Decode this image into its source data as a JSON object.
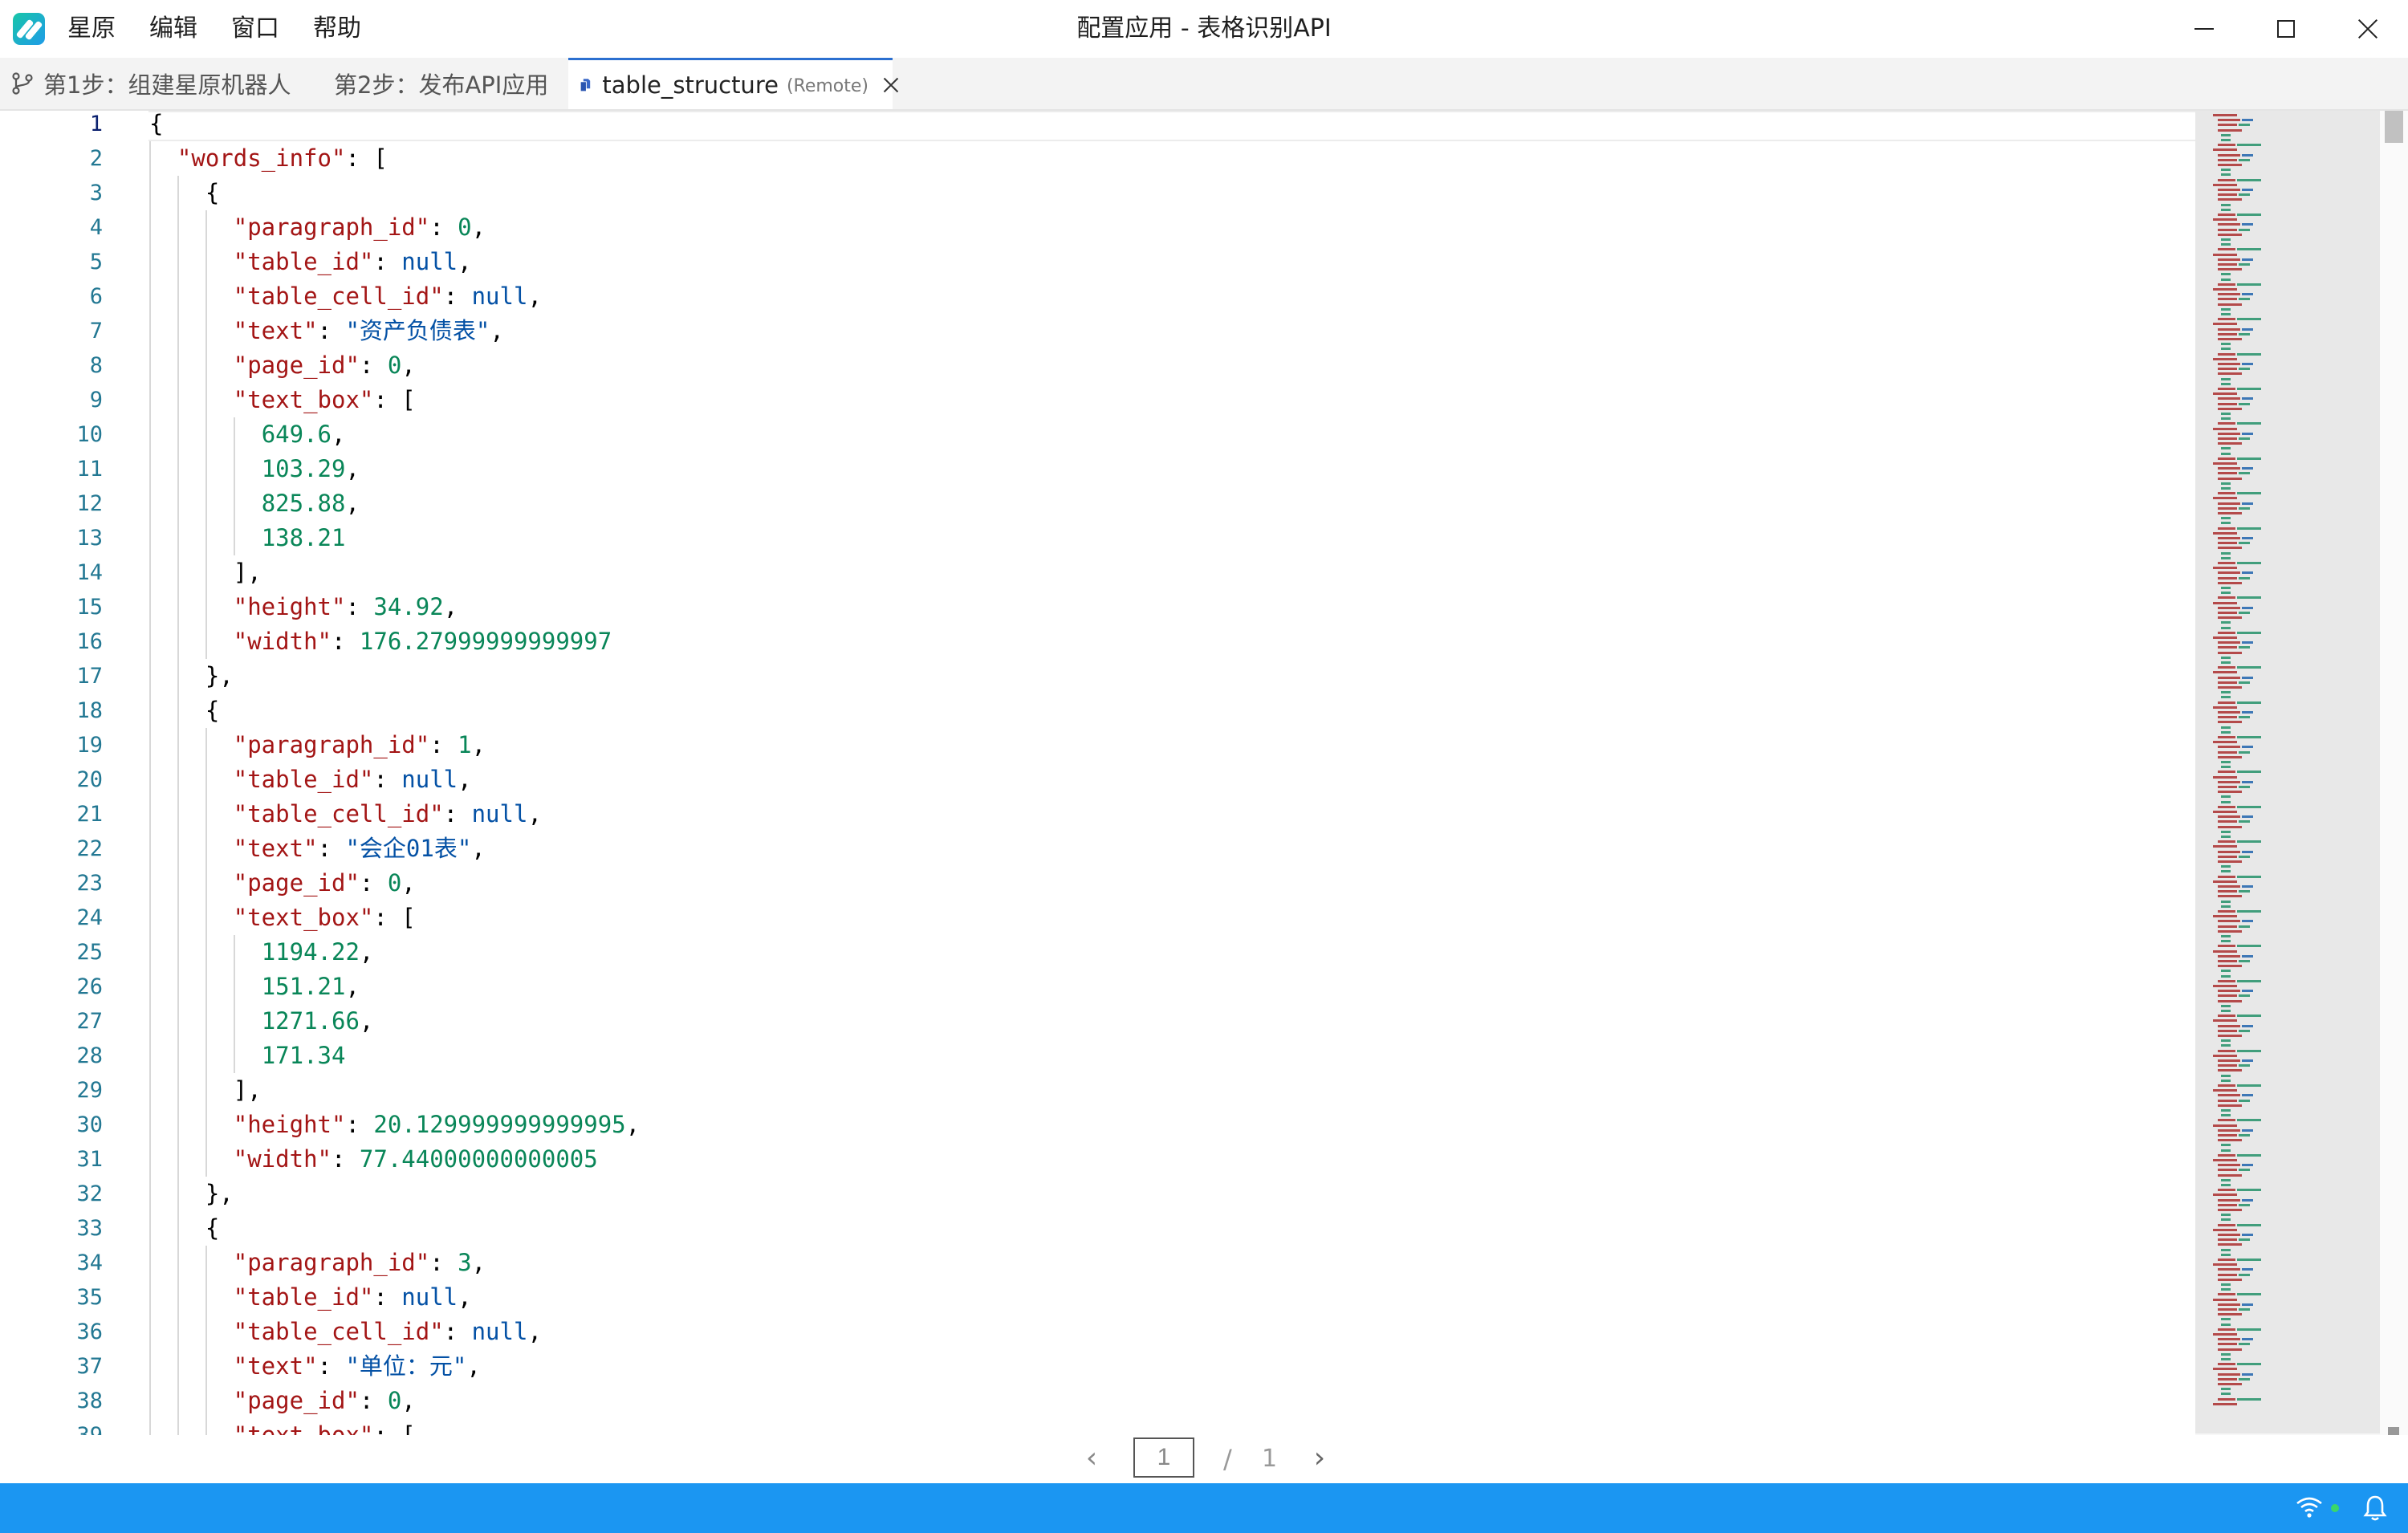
{
  "app": {
    "window_title": "配置应用 - 表格识别API",
    "menu": [
      "星原",
      "编辑",
      "窗口",
      "帮助"
    ]
  },
  "tabs": [
    {
      "label": "第1步：组建星原机器人",
      "icon": "branch-icon",
      "active": false
    },
    {
      "label": "第2步：发布API应用",
      "active": false
    },
    {
      "label": "table_structure",
      "tag": "(Remote)",
      "icon": "file-copy-icon",
      "active": true
    }
  ],
  "editor": {
    "current_line": 1,
    "lines": [
      [
        {
          "t": "{",
          "c": "p"
        }
      ],
      [
        {
          "t": "  "
        },
        {
          "t": "\"words_info\"",
          "c": "k"
        },
        {
          "t": ": [",
          "c": "p"
        }
      ],
      [
        {
          "t": "    {",
          "c": "p"
        }
      ],
      [
        {
          "t": "      "
        },
        {
          "t": "\"paragraph_id\"",
          "c": "k"
        },
        {
          "t": ": ",
          "c": "p"
        },
        {
          "t": "0",
          "c": "n"
        },
        {
          "t": ",",
          "c": "p"
        }
      ],
      [
        {
          "t": "      "
        },
        {
          "t": "\"table_id\"",
          "c": "k"
        },
        {
          "t": ": ",
          "c": "p"
        },
        {
          "t": "null",
          "c": "l"
        },
        {
          "t": ",",
          "c": "p"
        }
      ],
      [
        {
          "t": "      "
        },
        {
          "t": "\"table_cell_id\"",
          "c": "k"
        },
        {
          "t": ": ",
          "c": "p"
        },
        {
          "t": "null",
          "c": "l"
        },
        {
          "t": ",",
          "c": "p"
        }
      ],
      [
        {
          "t": "      "
        },
        {
          "t": "\"text\"",
          "c": "k"
        },
        {
          "t": ": ",
          "c": "p"
        },
        {
          "t": "\"资产负债表\"",
          "c": "s"
        },
        {
          "t": ",",
          "c": "p"
        }
      ],
      [
        {
          "t": "      "
        },
        {
          "t": "\"page_id\"",
          "c": "k"
        },
        {
          "t": ": ",
          "c": "p"
        },
        {
          "t": "0",
          "c": "n"
        },
        {
          "t": ",",
          "c": "p"
        }
      ],
      [
        {
          "t": "      "
        },
        {
          "t": "\"text_box\"",
          "c": "k"
        },
        {
          "t": ": [",
          "c": "p"
        }
      ],
      [
        {
          "t": "        "
        },
        {
          "t": "649.6",
          "c": "n"
        },
        {
          "t": ",",
          "c": "p"
        }
      ],
      [
        {
          "t": "        "
        },
        {
          "t": "103.29",
          "c": "n"
        },
        {
          "t": ",",
          "c": "p"
        }
      ],
      [
        {
          "t": "        "
        },
        {
          "t": "825.88",
          "c": "n"
        },
        {
          "t": ",",
          "c": "p"
        }
      ],
      [
        {
          "t": "        "
        },
        {
          "t": "138.21",
          "c": "n"
        }
      ],
      [
        {
          "t": "      ],",
          "c": "p"
        }
      ],
      [
        {
          "t": "      "
        },
        {
          "t": "\"height\"",
          "c": "k"
        },
        {
          "t": ": ",
          "c": "p"
        },
        {
          "t": "34.92",
          "c": "n"
        },
        {
          "t": ",",
          "c": "p"
        }
      ],
      [
        {
          "t": "      "
        },
        {
          "t": "\"width\"",
          "c": "k"
        },
        {
          "t": ": ",
          "c": "p"
        },
        {
          "t": "176.27999999999997",
          "c": "n"
        }
      ],
      [
        {
          "t": "    },",
          "c": "p"
        }
      ],
      [
        {
          "t": "    {",
          "c": "p"
        }
      ],
      [
        {
          "t": "      "
        },
        {
          "t": "\"paragraph_id\"",
          "c": "k"
        },
        {
          "t": ": ",
          "c": "p"
        },
        {
          "t": "1",
          "c": "n"
        },
        {
          "t": ",",
          "c": "p"
        }
      ],
      [
        {
          "t": "      "
        },
        {
          "t": "\"table_id\"",
          "c": "k"
        },
        {
          "t": ": ",
          "c": "p"
        },
        {
          "t": "null",
          "c": "l"
        },
        {
          "t": ",",
          "c": "p"
        }
      ],
      [
        {
          "t": "      "
        },
        {
          "t": "\"table_cell_id\"",
          "c": "k"
        },
        {
          "t": ": ",
          "c": "p"
        },
        {
          "t": "null",
          "c": "l"
        },
        {
          "t": ",",
          "c": "p"
        }
      ],
      [
        {
          "t": "      "
        },
        {
          "t": "\"text\"",
          "c": "k"
        },
        {
          "t": ": ",
          "c": "p"
        },
        {
          "t": "\"会企01表\"",
          "c": "s"
        },
        {
          "t": ",",
          "c": "p"
        }
      ],
      [
        {
          "t": "      "
        },
        {
          "t": "\"page_id\"",
          "c": "k"
        },
        {
          "t": ": ",
          "c": "p"
        },
        {
          "t": "0",
          "c": "n"
        },
        {
          "t": ",",
          "c": "p"
        }
      ],
      [
        {
          "t": "      "
        },
        {
          "t": "\"text_box\"",
          "c": "k"
        },
        {
          "t": ": [",
          "c": "p"
        }
      ],
      [
        {
          "t": "        "
        },
        {
          "t": "1194.22",
          "c": "n"
        },
        {
          "t": ",",
          "c": "p"
        }
      ],
      [
        {
          "t": "        "
        },
        {
          "t": "151.21",
          "c": "n"
        },
        {
          "t": ",",
          "c": "p"
        }
      ],
      [
        {
          "t": "        "
        },
        {
          "t": "1271.66",
          "c": "n"
        },
        {
          "t": ",",
          "c": "p"
        }
      ],
      [
        {
          "t": "        "
        },
        {
          "t": "171.34",
          "c": "n"
        }
      ],
      [
        {
          "t": "      ],",
          "c": "p"
        }
      ],
      [
        {
          "t": "      "
        },
        {
          "t": "\"height\"",
          "c": "k"
        },
        {
          "t": ": ",
          "c": "p"
        },
        {
          "t": "20.129999999999995",
          "c": "n"
        },
        {
          "t": ",",
          "c": "p"
        }
      ],
      [
        {
          "t": "      "
        },
        {
          "t": "\"width\"",
          "c": "k"
        },
        {
          "t": ": ",
          "c": "p"
        },
        {
          "t": "77.44000000000005",
          "c": "n"
        }
      ],
      [
        {
          "t": "    },",
          "c": "p"
        }
      ],
      [
        {
          "t": "    {",
          "c": "p"
        }
      ],
      [
        {
          "t": "      "
        },
        {
          "t": "\"paragraph_id\"",
          "c": "k"
        },
        {
          "t": ": ",
          "c": "p"
        },
        {
          "t": "3",
          "c": "n"
        },
        {
          "t": ",",
          "c": "p"
        }
      ],
      [
        {
          "t": "      "
        },
        {
          "t": "\"table_id\"",
          "c": "k"
        },
        {
          "t": ": ",
          "c": "p"
        },
        {
          "t": "null",
          "c": "l"
        },
        {
          "t": ",",
          "c": "p"
        }
      ],
      [
        {
          "t": "      "
        },
        {
          "t": "\"table_cell_id\"",
          "c": "k"
        },
        {
          "t": ": ",
          "c": "p"
        },
        {
          "t": "null",
          "c": "l"
        },
        {
          "t": ",",
          "c": "p"
        }
      ],
      [
        {
          "t": "      "
        },
        {
          "t": "\"text\"",
          "c": "k"
        },
        {
          "t": ": ",
          "c": "p"
        },
        {
          "t": "\"单位：元\"",
          "c": "s"
        },
        {
          "t": ",",
          "c": "p"
        }
      ],
      [
        {
          "t": "      "
        },
        {
          "t": "\"page_id\"",
          "c": "k"
        },
        {
          "t": ": ",
          "c": "p"
        },
        {
          "t": "0",
          "c": "n"
        },
        {
          "t": ",",
          "c": "p"
        }
      ],
      [
        {
          "t": "      "
        },
        {
          "t": "\"text_box\"",
          "c": "k"
        },
        {
          "t": ": [",
          "c": "p"
        }
      ]
    ]
  },
  "pager": {
    "current": "1",
    "separator": "/",
    "total": "1",
    "prev_icon": "chevron-left-icon",
    "next_icon": "chevron-right-icon"
  },
  "statusbar": {
    "icons": [
      "wifi-icon",
      "online-dot",
      "bell-icon"
    ]
  },
  "colors": {
    "key": "#a31515",
    "number": "#098658",
    "literal": "#0451a5",
    "string": "#0451a5",
    "punct": "#000000",
    "line_number": "#237893",
    "accent": "#1b96f2",
    "active_tab": "#2b6fd0"
  }
}
